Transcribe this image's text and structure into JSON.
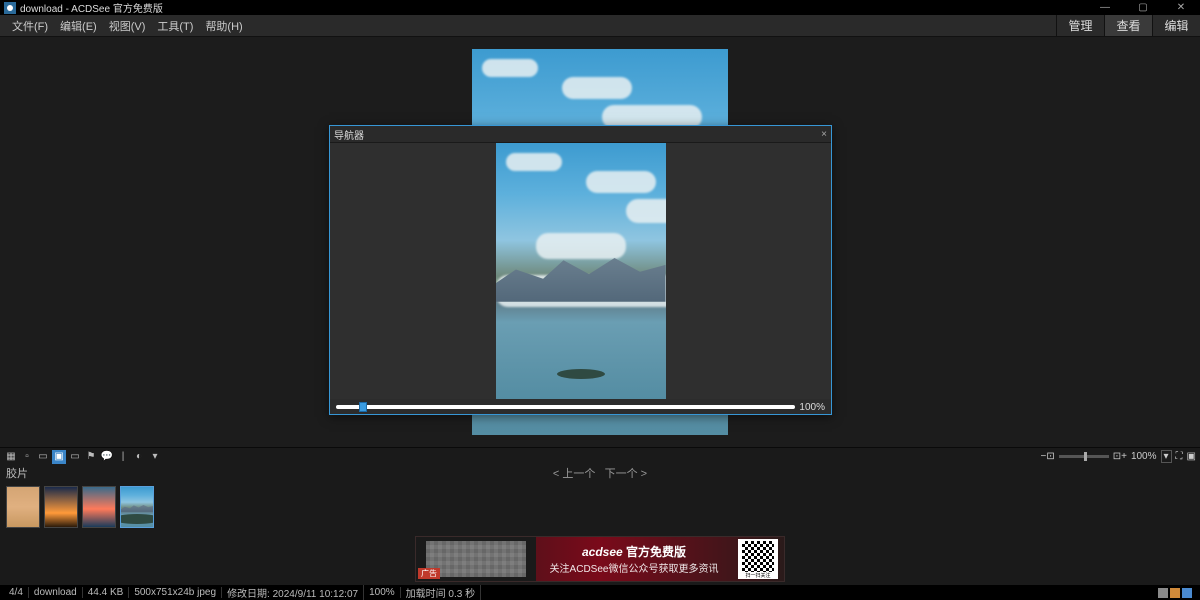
{
  "window": {
    "title": "download - ACDSee 官方免费版",
    "controls": {
      "min": "—",
      "max": "▢",
      "close": "✕"
    }
  },
  "menu": {
    "items": [
      "文件(F)",
      "编辑(E)",
      "视图(V)",
      "工具(T)",
      "帮助(H)"
    ],
    "tabs": [
      "管理",
      "查看",
      "编辑"
    ],
    "active_tab": "查看"
  },
  "navigator": {
    "title": "导航器",
    "close": "×",
    "zoom": "100%"
  },
  "toolbar": {
    "zoom_label": "100%",
    "zoom_dropdown": "▾"
  },
  "strip": {
    "label": "胶片",
    "prev": "< 上一个",
    "next": "下一个 >"
  },
  "ad": {
    "brand": "acdsee",
    "title_suffix": "官方免费版",
    "subtitle": "关注ACDSee微信公众号获取更多资讯",
    "qr_label": "扫一扫关注",
    "tag": "广告"
  },
  "status": {
    "index": "4/4",
    "folder": "download",
    "size": "44.4 KB",
    "dims": "500x751x24b jpeg",
    "modified": "修改日期: 2024/9/11 10:12:07",
    "zoom": "100%",
    "load": "加载时间 0.3 秒"
  }
}
